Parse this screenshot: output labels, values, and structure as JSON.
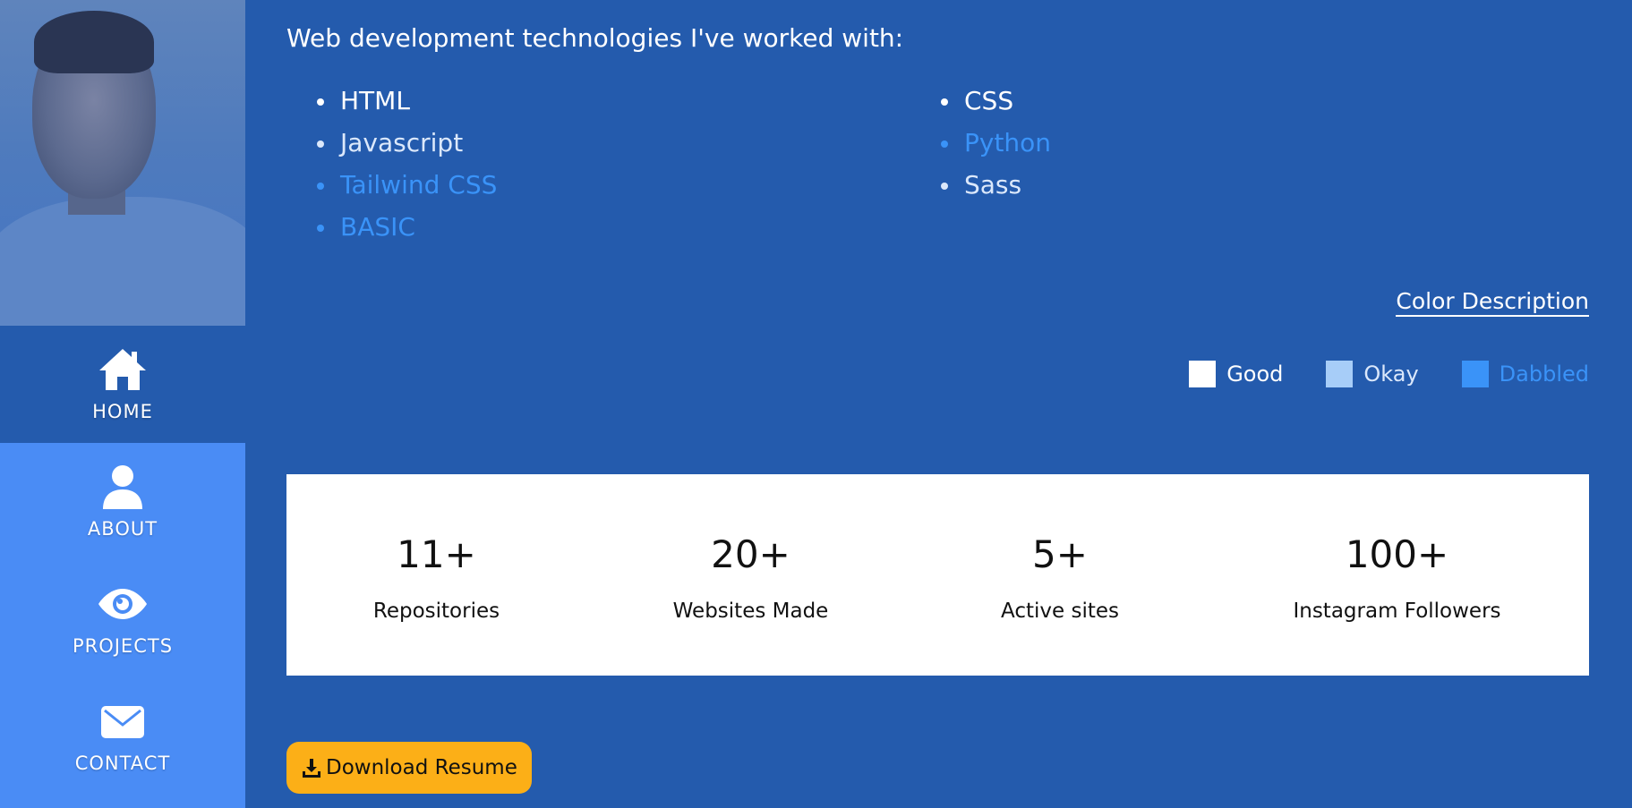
{
  "sidebar": {
    "nav": [
      {
        "label": "HOME",
        "icon": "home-icon",
        "active": true
      },
      {
        "label": "ABOUT",
        "icon": "user-icon",
        "active": false
      },
      {
        "label": "PROJECTS",
        "icon": "eye-icon",
        "active": false
      },
      {
        "label": "CONTACT",
        "icon": "envelope-icon",
        "active": false
      }
    ]
  },
  "main": {
    "heading": "Web development technologies I've worked with:",
    "technologies_left": [
      {
        "name": "HTML",
        "level": "Good"
      },
      {
        "name": "Javascript",
        "level": "Okay"
      },
      {
        "name": "Tailwind CSS",
        "level": "Dabbled"
      },
      {
        "name": "BASIC",
        "level": "Dabbled"
      }
    ],
    "technologies_right": [
      {
        "name": "CSS",
        "level": "Good"
      },
      {
        "name": "Python",
        "level": "Dabbled"
      },
      {
        "name": "Sass",
        "level": "Okay"
      }
    ],
    "color_description": "Color Description",
    "legend": [
      {
        "label": "Good",
        "color": "#ffffff"
      },
      {
        "label": "Okay",
        "color": "#a7cdf8"
      },
      {
        "label": "Dabbled",
        "color": "#3a93f8"
      }
    ],
    "stats": [
      {
        "value": "11+",
        "label": "Repositories"
      },
      {
        "value": "20+",
        "label": "Websites Made"
      },
      {
        "value": "5+",
        "label": "Active sites"
      },
      {
        "value": "100+",
        "label": "Instagram Followers"
      }
    ],
    "download_label": "Download Resume"
  },
  "colors": {
    "background": "#245bad",
    "sidebar": "#4a8cf5",
    "button": "#fcaf17",
    "good": "#ffffff",
    "okay": "#dbe8fb",
    "dabbled": "#3a93f8"
  }
}
